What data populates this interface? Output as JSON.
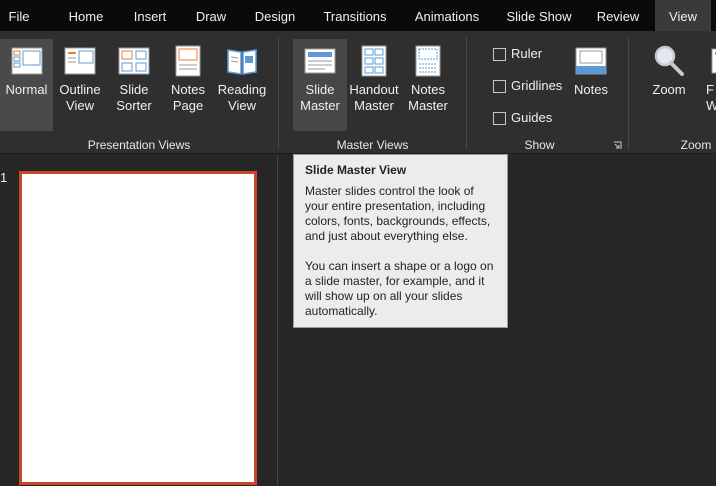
{
  "tabs": [
    {
      "label": "File"
    },
    {
      "label": "Home"
    },
    {
      "label": "Insert"
    },
    {
      "label": "Draw"
    },
    {
      "label": "Design"
    },
    {
      "label": "Transitions"
    },
    {
      "label": "Animations"
    },
    {
      "label": "Slide Show"
    },
    {
      "label": "Review"
    },
    {
      "label": "View"
    }
  ],
  "ribbon": {
    "presentation_views": {
      "label": "Presentation Views",
      "buttons": [
        {
          "l1": "Normal",
          "l2": ""
        },
        {
          "l1": "Outline",
          "l2": "View"
        },
        {
          "l1": "Slide",
          "l2": "Sorter"
        },
        {
          "l1": "Notes",
          "l2": "Page"
        },
        {
          "l1": "Reading",
          "l2": "View"
        }
      ]
    },
    "master_views": {
      "label": "Master Views",
      "buttons": [
        {
          "l1": "Slide",
          "l2": "Master"
        },
        {
          "l1": "Handout",
          "l2": "Master"
        },
        {
          "l1": "Notes",
          "l2": "Master"
        }
      ]
    },
    "show": {
      "label": "Show",
      "checkboxes": [
        {
          "label": "Ruler",
          "checked": false
        },
        {
          "label": "Gridlines",
          "checked": false
        },
        {
          "label": "Guides",
          "checked": false
        }
      ],
      "notes_button": {
        "l1": "Notes"
      }
    },
    "zoom": {
      "label": "Zoom",
      "zoom_button": {
        "l1": "Zoom"
      },
      "fit_button": {
        "l1": "F",
        "l2": "Wi"
      }
    }
  },
  "thumbnails": {
    "slide_number": "1"
  },
  "tooltip": {
    "title": "Slide Master View",
    "p1": "Master slides control the look of your entire presentation, including colors, fonts, backgrounds, effects, and just about everything else.",
    "p2": "You can insert a shape or a logo on a slide master, for example, and it will show up on all your slides automatically."
  },
  "colors": {
    "accent": "#c8472b",
    "icon_blue": "#5b9bd5",
    "icon_orange": "#ed7d31"
  }
}
